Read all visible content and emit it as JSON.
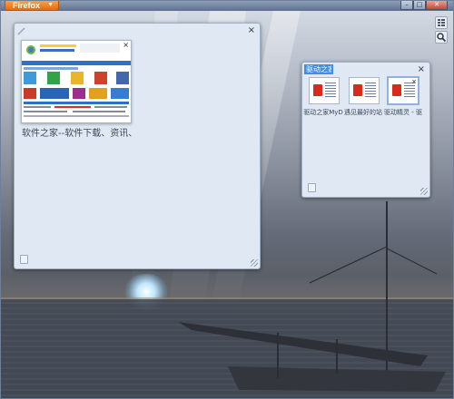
{
  "browser": {
    "menu_button_label": "Firefox",
    "menu_caret": "▼",
    "window_controls": {
      "minimize": "–",
      "maximize": "□",
      "close": "✕"
    }
  },
  "toolbar_icons": {
    "group_view": "group-view-icon",
    "search": "search-icon"
  },
  "groups": [
    {
      "title": "",
      "close_symbol": "×",
      "tabs": [
        {
          "title": "软件之家--软件下载、资讯、",
          "close_symbol": "×"
        }
      ]
    },
    {
      "title": "驱动之家",
      "close_symbol": "×",
      "tabs": [
        {
          "title": "驱动之家MyD"
        },
        {
          "title": "遇见最好的站"
        },
        {
          "title": "驱动精灵 - 驱",
          "close_symbol": "×",
          "active": true
        }
      ]
    }
  ]
}
